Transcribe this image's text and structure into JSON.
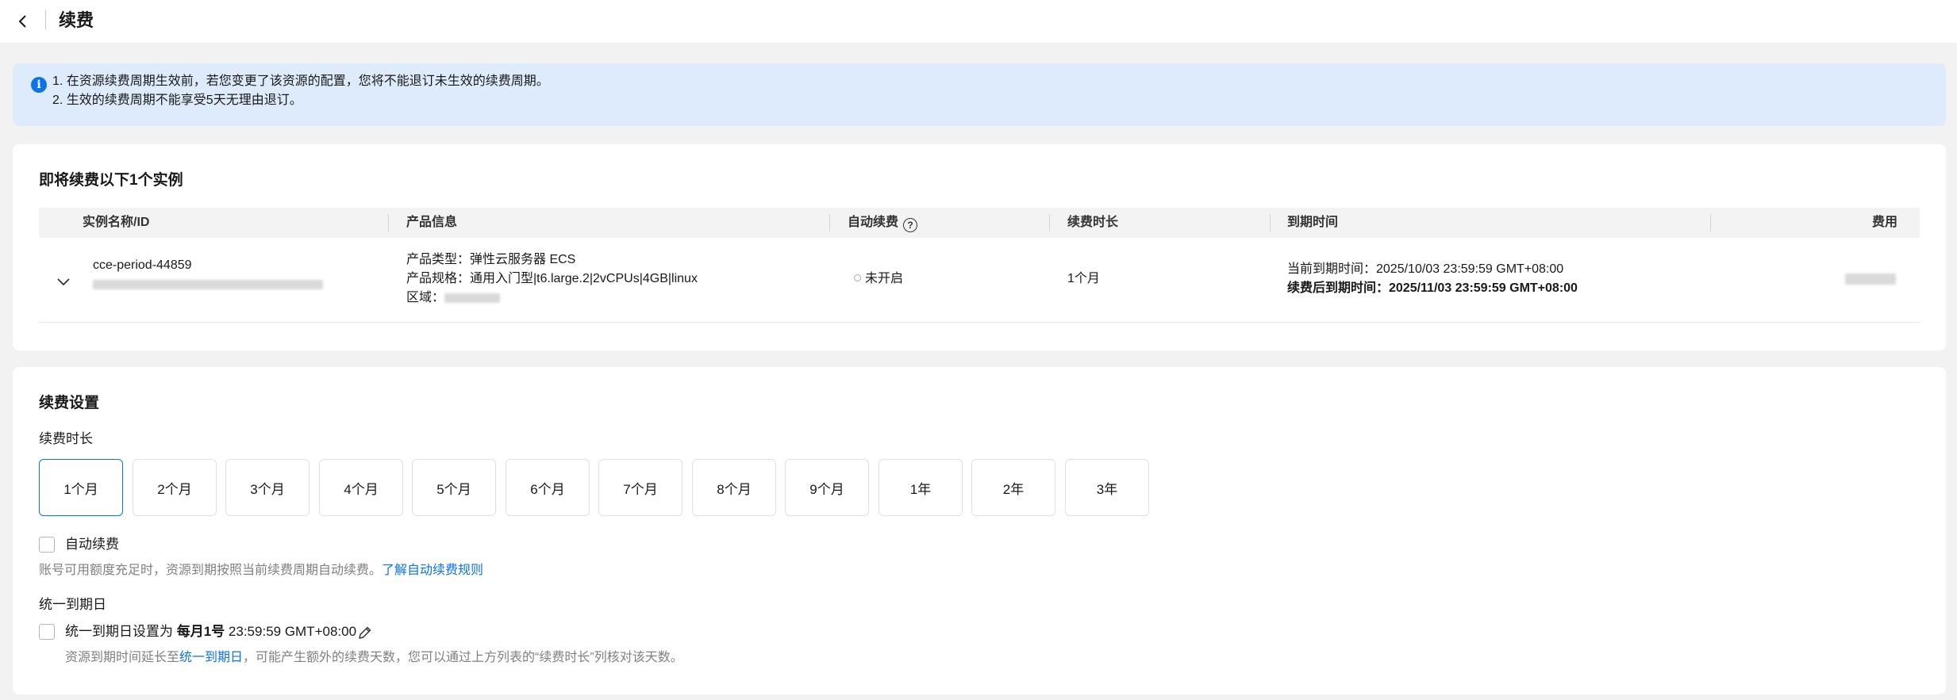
{
  "header": {
    "title": "续费"
  },
  "notice": {
    "lines": [
      "1. 在资源续费周期生效前，若您变更了该资源的配置，您将不能退订未生效的续费周期。",
      "2. 生效的续费周期不能享受5天无理由退订。"
    ]
  },
  "instances": {
    "title": "即将续费以下1个实例",
    "columns": [
      "实例名称/ID",
      "产品信息",
      "自动续费",
      "续费时长",
      "到期时间",
      "费用"
    ],
    "row": {
      "name": "cce-period-44859",
      "product_type": "产品类型：弹性云服务器 ECS",
      "product_spec": "产品规格：通用入门型|t6.large.2|2vCPUs|4GB|linux",
      "region_label": "区域：",
      "auto_renew": "未开启",
      "duration": "1个月",
      "current_expiry": "当前到期时间：2025/10/03 23:59:59 GMT+08:00",
      "renewed_expiry": "续费后到期时间：2025/11/03 23:59:59 GMT+08:00"
    }
  },
  "settings": {
    "title": "续费设置",
    "duration_label": "续费时长",
    "durations": [
      "1个月",
      "2个月",
      "3个月",
      "4个月",
      "5个月",
      "6个月",
      "7个月",
      "8个月",
      "9个月",
      "1年",
      "2年",
      "3年"
    ],
    "selected_duration": "1个月",
    "auto_renew_label": "自动续费",
    "auto_renew_hint": "账号可用额度充足时，资源到期按照当前续费周期自动续费。",
    "auto_renew_link": "了解自动续费规则",
    "unify_title": "统一到期日",
    "unify_prefix": "统一到期日设置为 ",
    "unify_day": "每月1号",
    "unify_time": " 23:59:59 GMT+08:00",
    "unify_hint_prefix": "资源到期时间延长至",
    "unify_hint_link": "统一到期日",
    "unify_hint_suffix": "，可能产生额外的续费天数，您可以通过上方列表的“续费时长”列核对该天数。"
  }
}
